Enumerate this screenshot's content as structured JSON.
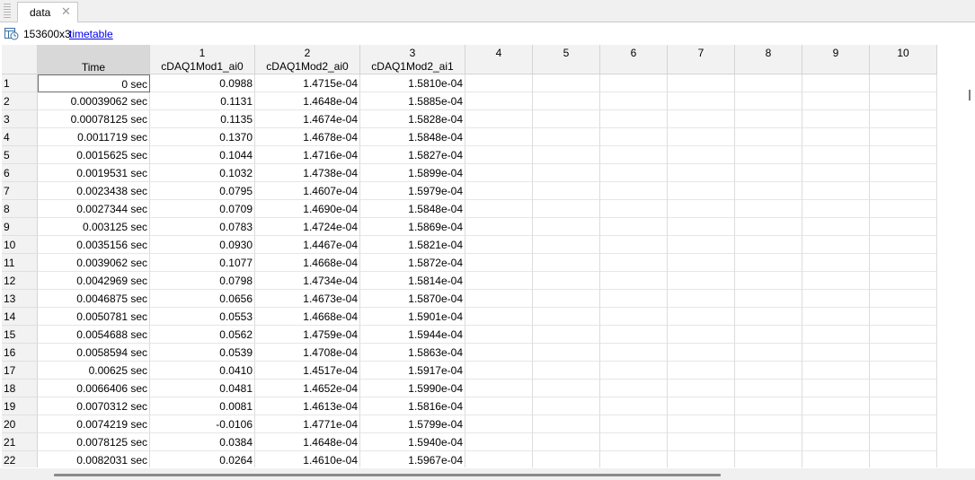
{
  "tab": {
    "label": "data",
    "close_glyph": "✕"
  },
  "info": {
    "dimensions": "153600x3",
    "class_link": "timetable"
  },
  "columns": [
    {
      "num": "",
      "name": "Time"
    },
    {
      "num": "1",
      "name": "cDAQ1Mod1_ai0"
    },
    {
      "num": "2",
      "name": "cDAQ1Mod2_ai0"
    },
    {
      "num": "3",
      "name": "cDAQ1Mod2_ai1"
    },
    {
      "num": "4",
      "name": ""
    },
    {
      "num": "5",
      "name": ""
    },
    {
      "num": "6",
      "name": ""
    },
    {
      "num": "7",
      "name": ""
    },
    {
      "num": "8",
      "name": ""
    },
    {
      "num": "9",
      "name": ""
    },
    {
      "num": "10",
      "name": ""
    }
  ],
  "rows": [
    [
      "1",
      "0 sec",
      "0.0988",
      "1.4715e-04",
      "1.5810e-04"
    ],
    [
      "2",
      "0.00039062 sec",
      "0.1131",
      "1.4648e-04",
      "1.5885e-04"
    ],
    [
      "3",
      "0.00078125 sec",
      "0.1135",
      "1.4674e-04",
      "1.5828e-04"
    ],
    [
      "4",
      "0.0011719 sec",
      "0.1370",
      "1.4678e-04",
      "1.5848e-04"
    ],
    [
      "5",
      "0.0015625 sec",
      "0.1044",
      "1.4716e-04",
      "1.5827e-04"
    ],
    [
      "6",
      "0.0019531 sec",
      "0.1032",
      "1.4738e-04",
      "1.5899e-04"
    ],
    [
      "7",
      "0.0023438 sec",
      "0.0795",
      "1.4607e-04",
      "1.5979e-04"
    ],
    [
      "8",
      "0.0027344 sec",
      "0.0709",
      "1.4690e-04",
      "1.5848e-04"
    ],
    [
      "9",
      "0.003125 sec",
      "0.0783",
      "1.4724e-04",
      "1.5869e-04"
    ],
    [
      "10",
      "0.0035156 sec",
      "0.0930",
      "1.4467e-04",
      "1.5821e-04"
    ],
    [
      "11",
      "0.0039062 sec",
      "0.1077",
      "1.4668e-04",
      "1.5872e-04"
    ],
    [
      "12",
      "0.0042969 sec",
      "0.0798",
      "1.4734e-04",
      "1.5814e-04"
    ],
    [
      "13",
      "0.0046875 sec",
      "0.0656",
      "1.4673e-04",
      "1.5870e-04"
    ],
    [
      "14",
      "0.0050781 sec",
      "0.0553",
      "1.4668e-04",
      "1.5901e-04"
    ],
    [
      "15",
      "0.0054688 sec",
      "0.0562",
      "1.4759e-04",
      "1.5944e-04"
    ],
    [
      "16",
      "0.0058594 sec",
      "0.0539",
      "1.4708e-04",
      "1.5863e-04"
    ],
    [
      "17",
      "0.00625 sec",
      "0.0410",
      "1.4517e-04",
      "1.5917e-04"
    ],
    [
      "18",
      "0.0066406 sec",
      "0.0481",
      "1.4652e-04",
      "1.5990e-04"
    ],
    [
      "19",
      "0.0070312 sec",
      "0.0081",
      "1.4613e-04",
      "1.5816e-04"
    ],
    [
      "20",
      "0.0074219 sec",
      "-0.0106",
      "1.4771e-04",
      "1.5799e-04"
    ],
    [
      "21",
      "0.0078125 sec",
      "0.0384",
      "1.4648e-04",
      "1.5940e-04"
    ],
    [
      "22",
      "0.0082031 sec",
      "0.0264",
      "1.4610e-04",
      "1.5967e-04"
    ]
  ]
}
